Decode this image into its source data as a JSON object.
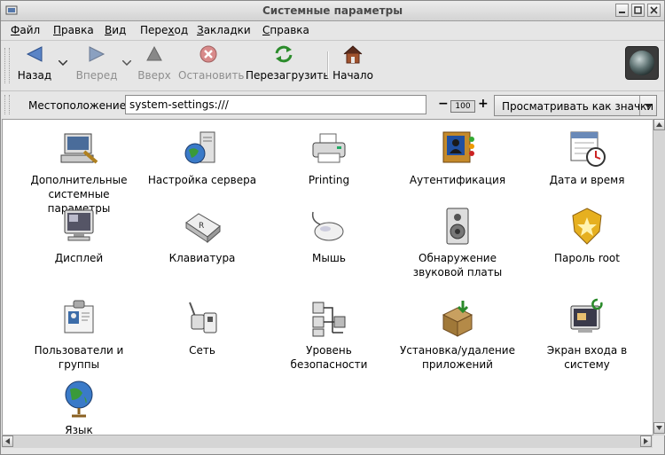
{
  "window": {
    "title": "Системные параметры"
  },
  "menubar": [
    {
      "label": "Файл",
      "ul": "Ф",
      "rest": "айл"
    },
    {
      "label": "Правка",
      "ul": "П",
      "rest": "равка"
    },
    {
      "label": "Вид",
      "ul": "В",
      "rest": "ид"
    },
    {
      "label": "Переход",
      "pre": "Пере",
      "ul": "х",
      "rest": "од"
    },
    {
      "label": "Закладки",
      "ul": "З",
      "rest": "акладки"
    },
    {
      "label": "Справка",
      "ul": "С",
      "rest": "правка"
    }
  ],
  "toolbar": {
    "back": "Назад",
    "forward": "Вперед",
    "up": "Вверх",
    "stop": "Остановить",
    "reload": "Перезагрузить",
    "home": "Начало"
  },
  "location": {
    "label": "Местоположение:",
    "value": "system-settings:///",
    "zoom": "100",
    "zoom_minus": "−",
    "zoom_plus": "+",
    "view_mode": "Просматривать как значки"
  },
  "items": [
    {
      "label": "Дополнительные системные параметры",
      "icon": "computer-tools-icon"
    },
    {
      "label": "Настройка сервера",
      "icon": "server-globe-icon"
    },
    {
      "label": "Printing",
      "icon": "printer-icon"
    },
    {
      "label": "Аутентификация",
      "icon": "authentication-icon"
    },
    {
      "label": "Дата и время",
      "icon": "calendar-clock-icon"
    },
    {
      "label": "Дисплей",
      "icon": "monitor-icon"
    },
    {
      "label": "Клавиатура",
      "icon": "keyboard-key-icon"
    },
    {
      "label": "Мышь",
      "icon": "mouse-icon"
    },
    {
      "label": "Обнаружение звуковой платы",
      "icon": "speaker-icon"
    },
    {
      "label": "Пароль root",
      "icon": "root-badge-icon"
    },
    {
      "label": "Пользователи и группы",
      "icon": "user-id-card-icon"
    },
    {
      "label": "Сеть",
      "icon": "network-plug-icon"
    },
    {
      "label": "Уровень безопасности",
      "icon": "security-level-icon"
    },
    {
      "label": "Установка/удаление приложений",
      "icon": "package-install-icon"
    },
    {
      "label": "Экран входа в систему",
      "icon": "login-screen-icon"
    },
    {
      "label": "Язык",
      "icon": "language-globe-icon"
    }
  ]
}
